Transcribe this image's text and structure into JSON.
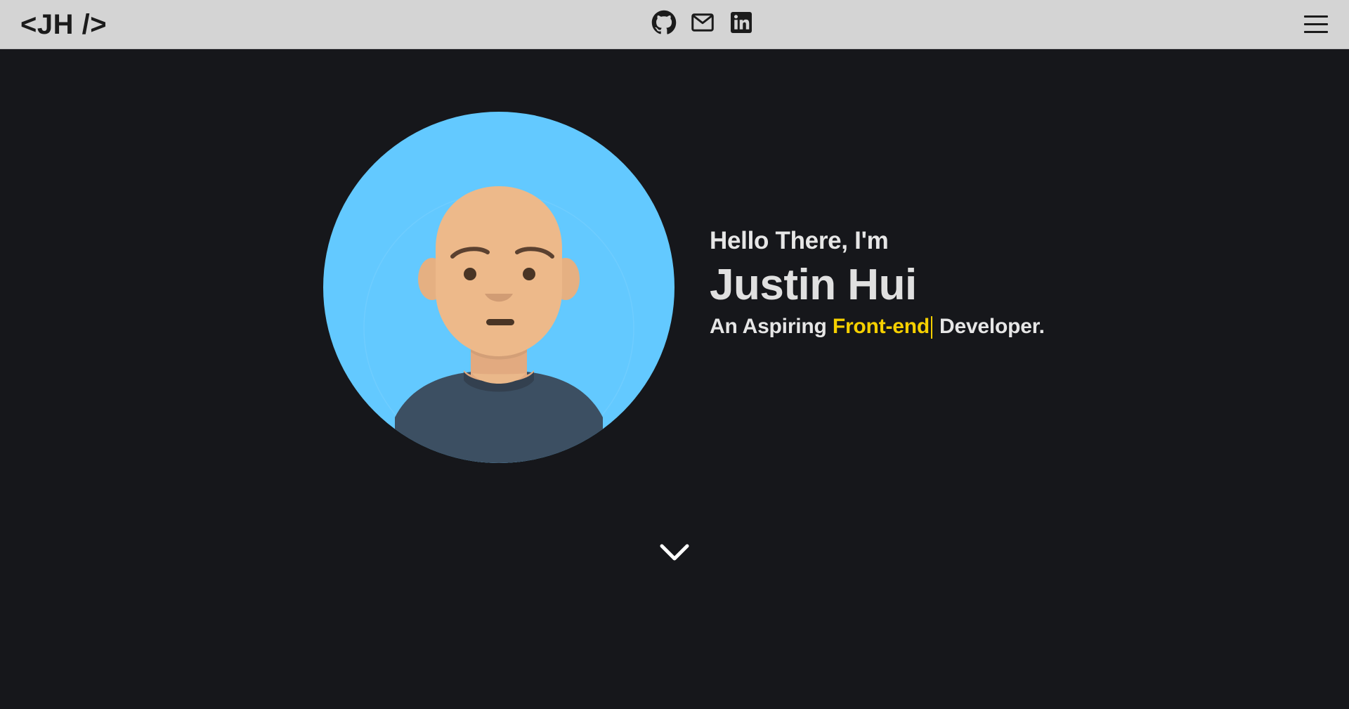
{
  "nav": {
    "logo": "<JH />",
    "social_icons": [
      "github-icon",
      "mail-icon",
      "linkedin-icon"
    ],
    "menu_icon": "hamburger-menu-icon"
  },
  "hero": {
    "greeting": "Hello There, I'm",
    "name": "Justin Hui",
    "tagline_prefix": "An Aspiring",
    "tagline_highlight": "Front-end",
    "tagline_suffix": "Developer.",
    "avatar_icon": "avatar-illustration",
    "scroll_icon": "chevron-down-icon"
  },
  "colors": {
    "navbar_bg": "#d4d4d4",
    "page_bg": "#16171b",
    "highlight": "#f5d000",
    "avatar_bg": "#63c9ff",
    "text": "#e6e6e6"
  }
}
